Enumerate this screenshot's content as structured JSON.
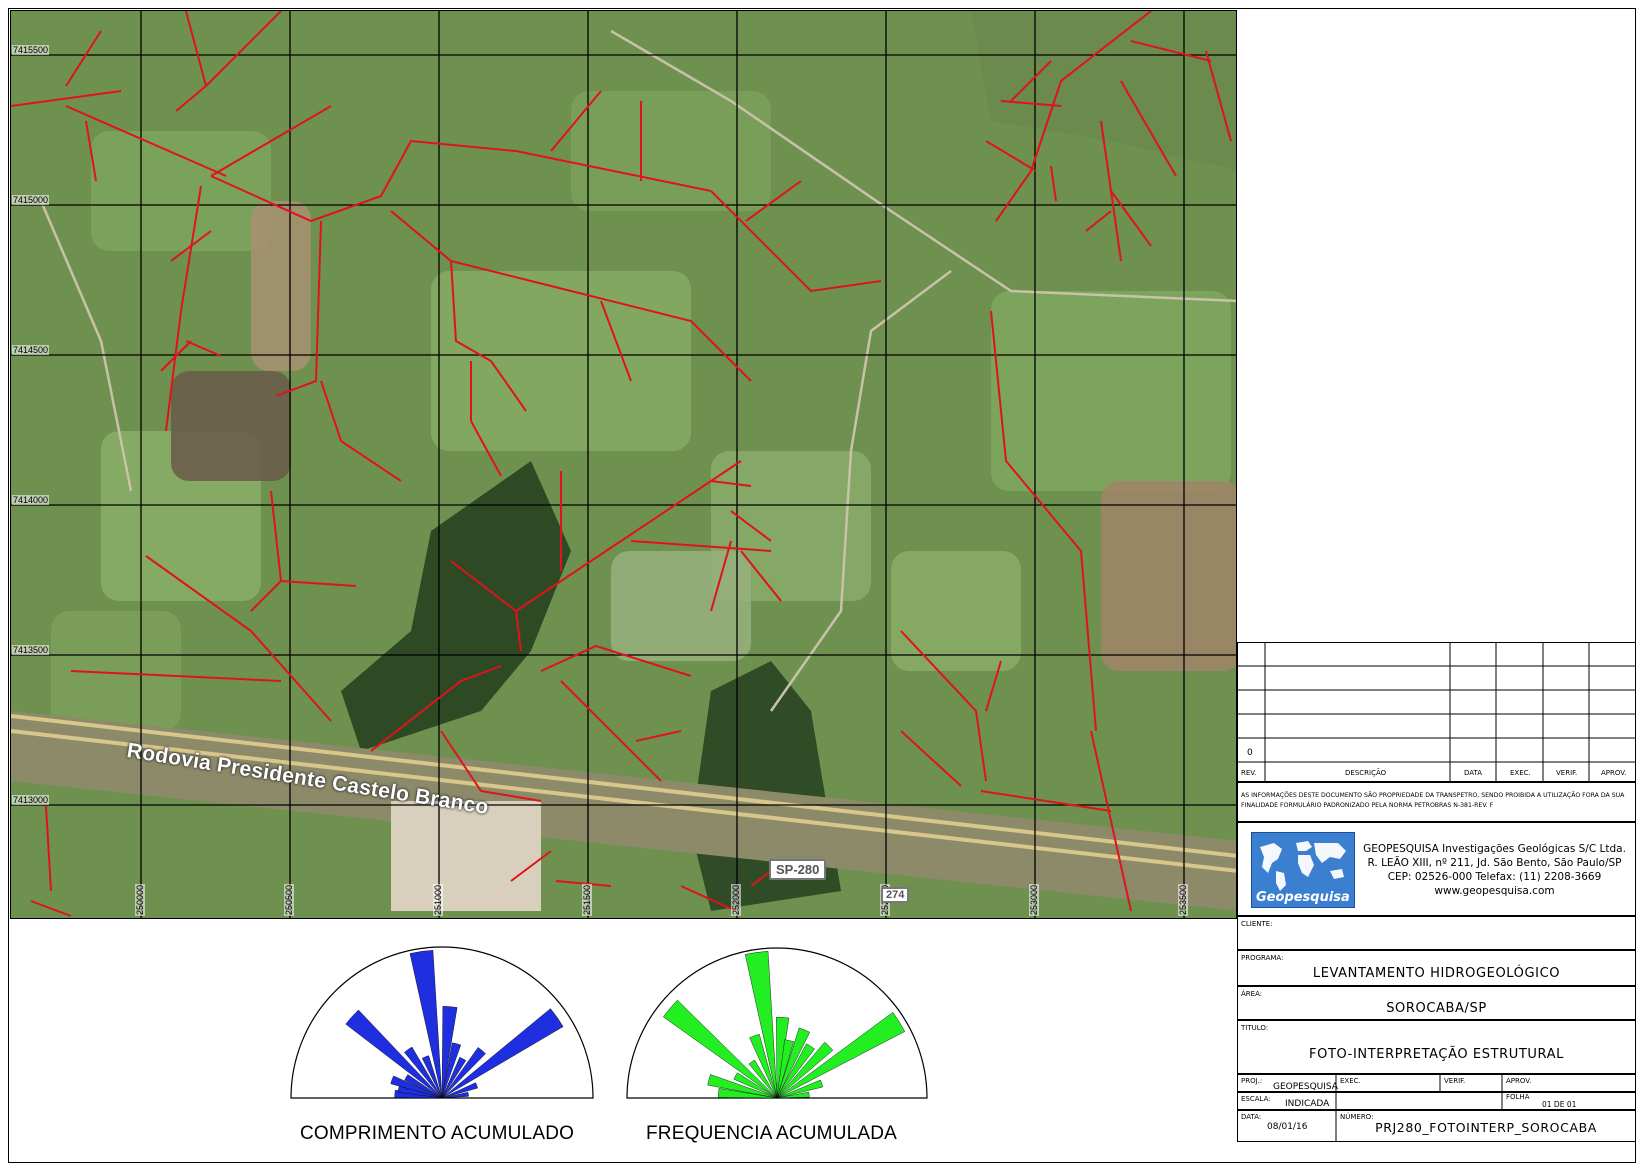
{
  "map": {
    "northing_labels": [
      "7415500",
      "7415000",
      "7414500",
      "7414000",
      "7413500",
      "7413000"
    ],
    "easting_labels": [
      "250000",
      "250500",
      "251000",
      "251500",
      "252000",
      "252500",
      "253000",
      "253500"
    ],
    "road_name": "Rodovia Presidente Castelo Branco",
    "road_shield": "SP-280",
    "road_shield_2": "274",
    "lineament_color": "#e0131c",
    "grid_color": "#000000"
  },
  "rose_diagrams": [
    {
      "title": "COMPRIMENTO ACUMULADO",
      "color": "#1f2fe0",
      "petals": [
        {
          "azimuth": -85,
          "length": 0.32
        },
        {
          "azimuth": -78,
          "length": 0.3
        },
        {
          "azimuth": -70,
          "length": 0.36
        },
        {
          "azimuth": -60,
          "length": 0.28
        },
        {
          "azimuth": -48,
          "length": 0.82
        },
        {
          "azimuth": -35,
          "length": 0.4
        },
        {
          "azimuth": -22,
          "length": 0.3
        },
        {
          "azimuth": -8,
          "length": 1.0
        },
        {
          "azimuth": 5,
          "length": 0.62
        },
        {
          "azimuth": 15,
          "length": 0.38
        },
        {
          "azimuth": 28,
          "length": 0.3
        },
        {
          "azimuth": 40,
          "length": 0.42
        },
        {
          "azimuth": 55,
          "length": 0.95
        },
        {
          "azimuth": 70,
          "length": 0.25
        },
        {
          "azimuth": 82,
          "length": 0.18
        }
      ]
    },
    {
      "title": "FREQUENCIA ACUMULADA",
      "color": "#22ee22",
      "petals": [
        {
          "azimuth": -85,
          "length": 0.4
        },
        {
          "azimuth": -75,
          "length": 0.48
        },
        {
          "azimuth": -62,
          "length": 0.32
        },
        {
          "azimuth": -50,
          "length": 0.95
        },
        {
          "azimuth": -35,
          "length": 0.3
        },
        {
          "azimuth": -20,
          "length": 0.45
        },
        {
          "azimuth": -8,
          "length": 1.0
        },
        {
          "azimuth": 4,
          "length": 0.55
        },
        {
          "azimuth": 12,
          "length": 0.4
        },
        {
          "azimuth": 22,
          "length": 0.5
        },
        {
          "azimuth": 33,
          "length": 0.42
        },
        {
          "azimuth": 45,
          "length": 0.5
        },
        {
          "azimuth": 58,
          "length": 0.98
        },
        {
          "azimuth": 72,
          "length": 0.32
        },
        {
          "azimuth": 84,
          "length": 0.22
        }
      ]
    }
  ],
  "title_block": {
    "rev_row_value": "0",
    "rev_headers": [
      "REV.",
      "DESCRIÇÃO",
      "DATA",
      "EXEC.",
      "VERIF.",
      "APROV."
    ],
    "notice": "AS INFORMAÇÕES DESTE DOCUMENTO SÃO PROPRIEDADE DA TRANSPETRO, SENDO PROIBIDA A UTILIZAÇÃO FORA DA SUA FINALIDADE FORMULÁRIO PADRONIZADO PELA NORMA PETROBRAS N-381-REV. F",
    "logo_text": "Geopesquisa",
    "company_lines": [
      "GEOPESQUISA Investigações Geológicas S/C Ltda.",
      "R. LEÃO XIII, nº 211, Jd. São Bento, São Paulo/SP",
      "CEP: 02526-000     Telefax: (11) 2208-3669",
      "www.geopesquisa.com"
    ],
    "cliente_label": "CLIENTE:",
    "programa_label": "PROGRAMA:",
    "programa_value": "LEVANTAMENTO HIDROGEOLÓGICO",
    "area_label": "ÁREA:",
    "area_value": "SOROCABA/SP",
    "titulo_label": "TITULO:",
    "titulo_value": "FOTO-INTERPRETAÇÃO ESTRUTURAL",
    "proj_label": "PROJ.:",
    "proj_value": "GEOPESQUISA",
    "exec_label": "EXEC.",
    "verif_label": "VERIF.",
    "aprov_label": "APROV.",
    "escala_label": "ESCALA:",
    "escala_value": "INDICADA",
    "folha_label": "FOLHA",
    "folha_value": "01  DE  01",
    "data_label": "DATA:",
    "data_value": "08/01/16",
    "numero_label": "NÚMERO:",
    "numero_value": "PRJ280_FOTOINTERP_SOROCABA"
  }
}
